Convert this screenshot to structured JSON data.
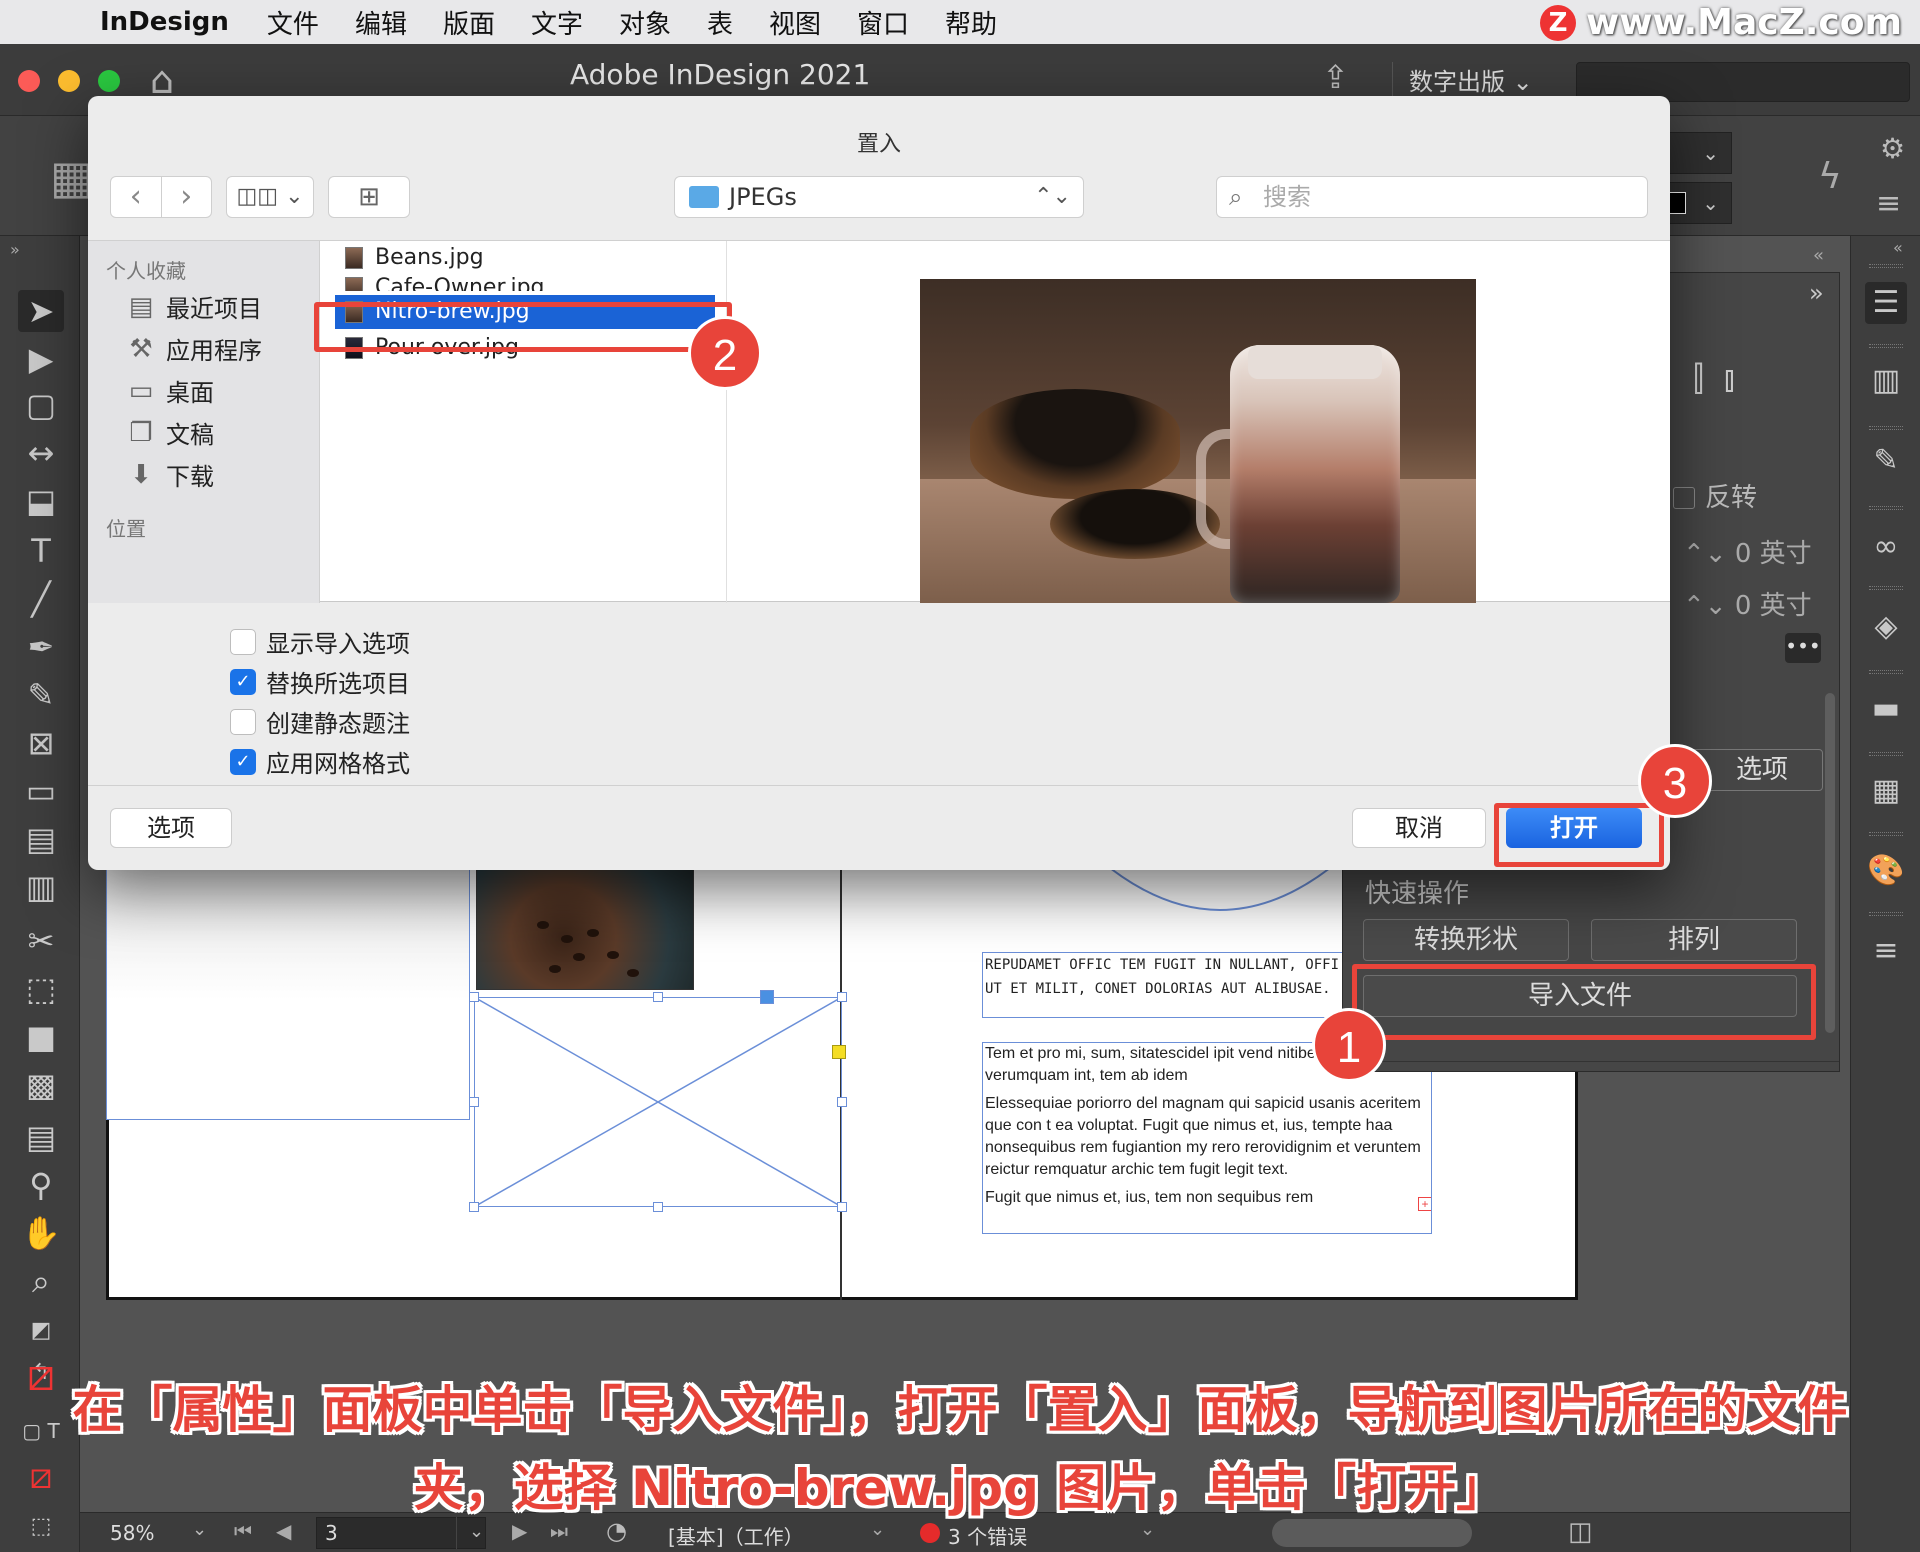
{
  "menubar": {
    "app": "InDesign",
    "items": [
      "文件",
      "编辑",
      "版面",
      "文字",
      "对象",
      "表",
      "视图",
      "窗口",
      "帮助"
    ],
    "watermark": "www.MacZ.com",
    "watermark_logo": "Z"
  },
  "titlebar": {
    "title": "Adobe InDesign 2021",
    "workspace": "数字出版"
  },
  "dialog": {
    "title": "置入",
    "folder": "JPEGs",
    "search_placeholder": "搜索",
    "sidebar": {
      "favorites_header": "个人收藏",
      "items": [
        {
          "label": "最近项目",
          "icon": "recents-icon"
        },
        {
          "label": "应用程序",
          "icon": "applications-icon"
        },
        {
          "label": "桌面",
          "icon": "desktop-icon"
        },
        {
          "label": "文稿",
          "icon": "documents-icon"
        },
        {
          "label": "下载",
          "icon": "downloads-icon"
        }
      ],
      "locations_header": "位置"
    },
    "files": [
      "Beans.jpg",
      "Cafe-Owner.jpg",
      "Nitro-brew.jpg",
      "Pour-over.jpg"
    ],
    "selected_file": "Nitro-brew.jpg",
    "options": [
      {
        "label": "显示导入选项",
        "checked": false
      },
      {
        "label": "替换所选项目",
        "checked": true
      },
      {
        "label": "创建静态题注",
        "checked": false
      },
      {
        "label": "应用网格格式",
        "checked": true
      }
    ],
    "options_button": "选项",
    "cancel_button": "取消",
    "open_button": "打开"
  },
  "properties": {
    "invert_label": "反转",
    "offset1": "0 英寸",
    "offset2": "0 英寸",
    "options_button": "选项",
    "quick_actions_title": "快速操作",
    "convert_shape_button": "转换形状",
    "arrange_button": "排列",
    "import_file_button": "导入文件"
  },
  "document": {
    "text_frame1": [
      "REPUDAMET OFFIC TEM FUGIT IN NULLANT, OFFI",
      "UT ET MILIT, CONET DOLORIAS AUT ALIBUSAE."
    ],
    "text_frame2": [
      "Tem et pro mi, sum, sitatescidel ipit vend nitiberum aut verumquam int, tem ab idem",
      "Elessequiae poriorro del magnam qui sapicid usanis aceritem que con t ea voluptat. Fugit que nimus et, ius, tempte haa nonsequibus rem fugiantion my rero rerovidignim et veruntem reictur remquatur archic tem fugit legit text.",
      "Fugit que nimus et, ius, tem non sequibus rem"
    ]
  },
  "statusbar": {
    "zoom": "58%",
    "page": "3",
    "profile": "[基本]（工作）",
    "errors": "3 个错误"
  },
  "annotations": {
    "badge1": "1",
    "badge2": "2",
    "badge3": "3"
  },
  "caption": {
    "line1": "在「属性」面板中单击「导入文件」，打开「置入」面板，导航到图片所在的文件",
    "line2": "夹，选择 Nitro-brew.jpg 图片，单击「打开」"
  },
  "colors": {
    "accent": "#e8443a",
    "selection": "#1a63d6",
    "primary_button": "#1a73e8"
  }
}
